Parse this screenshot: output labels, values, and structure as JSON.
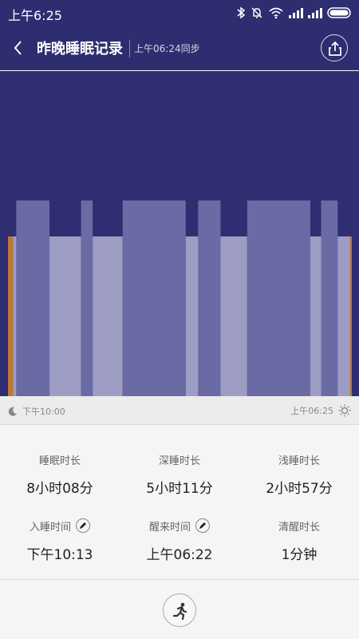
{
  "status_bar": {
    "time": "上午6:25"
  },
  "header": {
    "title": "昨晚睡眠记录",
    "sync_text": "上午06:24同步"
  },
  "chart_data": {
    "type": "bar",
    "description_units": "minutes since 22:00",
    "start_label": "下午10:00",
    "end_label": "上午06:25",
    "stages": [
      {
        "stage": "awake",
        "start": 0,
        "end": 6
      },
      {
        "stage": "light",
        "start": 6,
        "end": 10
      },
      {
        "stage": "deep",
        "start": 10,
        "end": 50
      },
      {
        "stage": "light",
        "start": 50,
        "end": 72
      },
      {
        "stage": "light",
        "start": 72,
        "end": 88
      },
      {
        "stage": "deep",
        "start": 88,
        "end": 102
      },
      {
        "stage": "light",
        "start": 102,
        "end": 138
      },
      {
        "stage": "deep",
        "start": 138,
        "end": 214
      },
      {
        "stage": "light",
        "start": 214,
        "end": 229
      },
      {
        "stage": "deep",
        "start": 229,
        "end": 256
      },
      {
        "stage": "light",
        "start": 256,
        "end": 288
      },
      {
        "stage": "deep",
        "start": 288,
        "end": 364
      },
      {
        "stage": "light",
        "start": 364,
        "end": 377
      },
      {
        "stage": "deep",
        "start": 377,
        "end": 397
      },
      {
        "stage": "light",
        "start": 397,
        "end": 412
      },
      {
        "stage": "awake",
        "start": 412,
        "end": 413
      }
    ],
    "colors": {
      "deep": "#6a6aa5",
      "light": "#9d9dc4",
      "awake": "#bf7633",
      "background": "#2f2e72"
    }
  },
  "stats": [
    {
      "label": "睡眠时长",
      "value": "8小时08分",
      "editable": false
    },
    {
      "label": "深睡时长",
      "value": "5小时11分",
      "editable": false
    },
    {
      "label": "浅睡时长",
      "value": "2小时57分",
      "editable": false
    },
    {
      "label": "入睡时间",
      "value": "下午10:13",
      "editable": true
    },
    {
      "label": "醒来时间",
      "value": "上午06:22",
      "editable": true
    },
    {
      "label": "清醒时长",
      "value": "1分钟",
      "editable": false
    }
  ],
  "icons": {
    "back": "chevron-left-icon",
    "share": "share-icon",
    "moon": "moon-icon",
    "sun": "sun-icon",
    "edit": "pencil-icon",
    "run": "running-person-icon"
  }
}
